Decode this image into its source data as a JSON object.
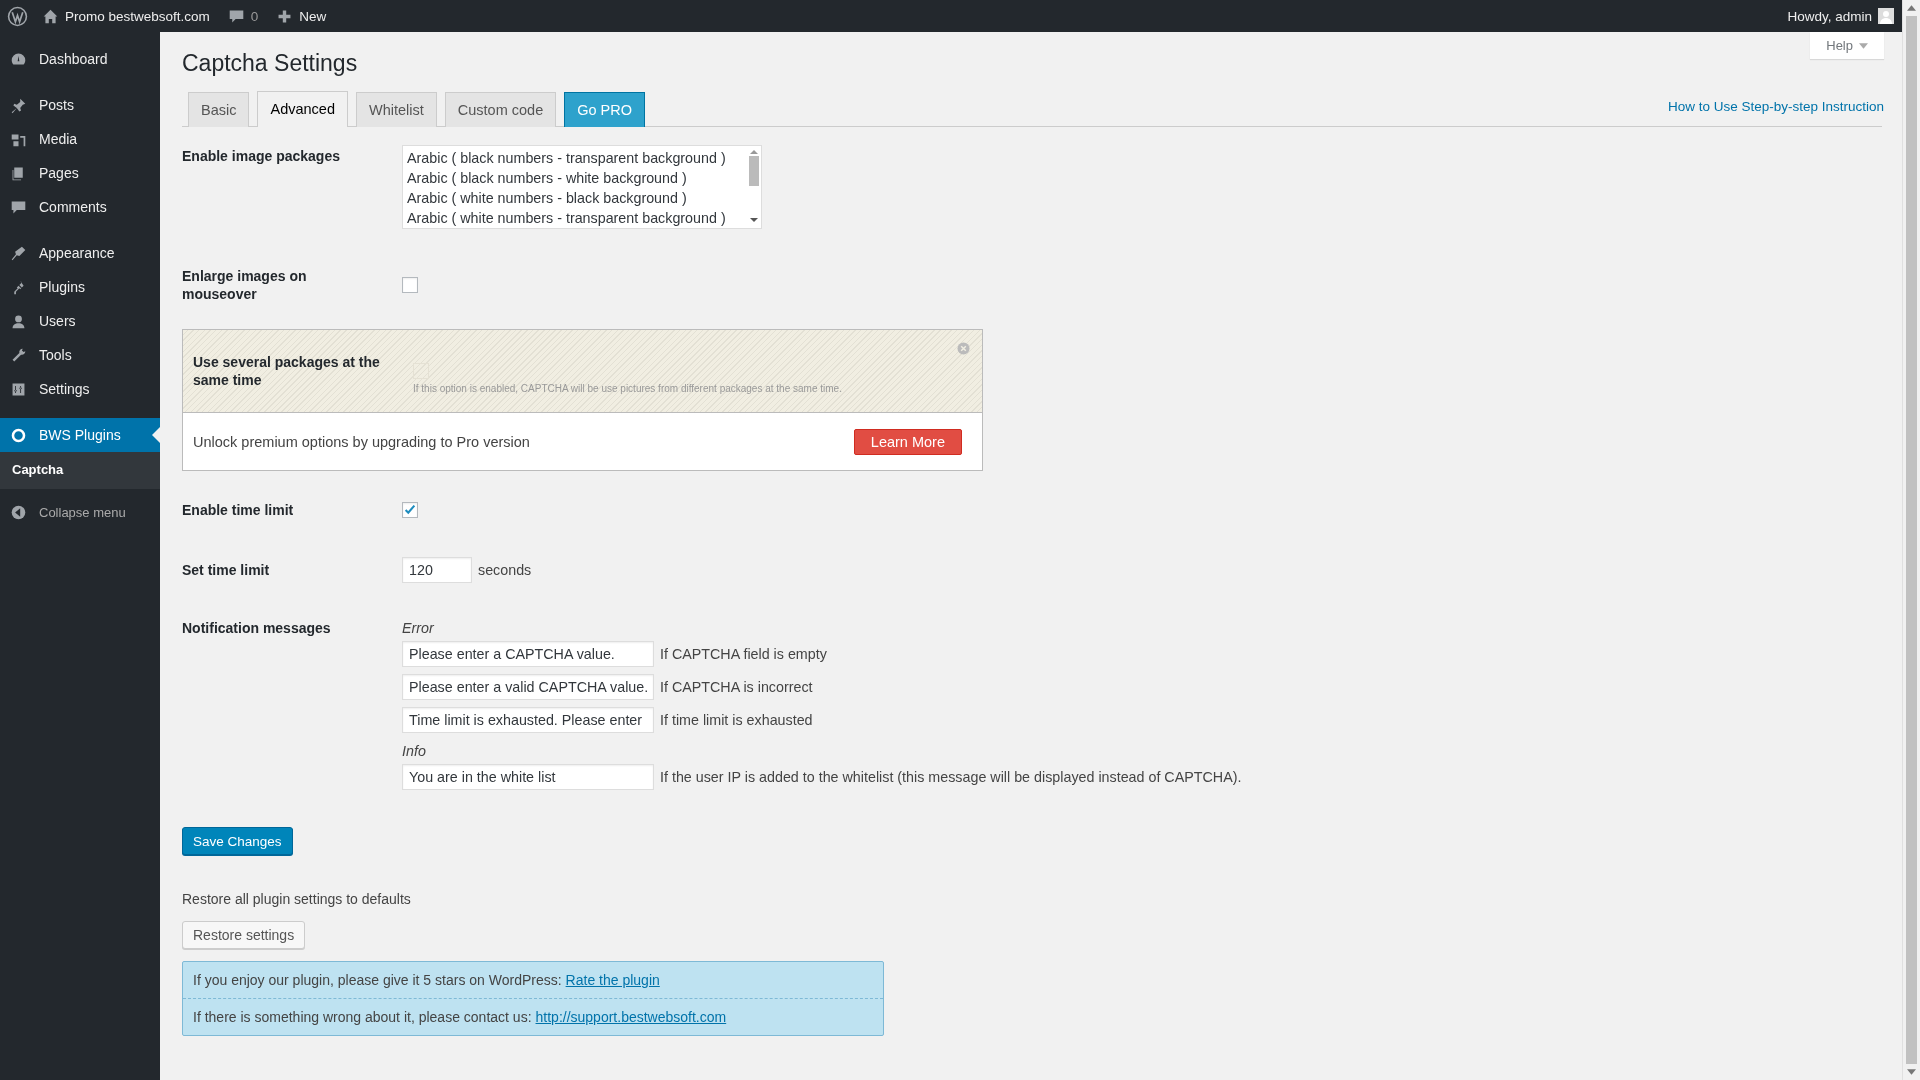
{
  "admin_bar": {
    "site": "Promo bestwebsoft.com",
    "comments": "0",
    "new": "New",
    "greeting": "Howdy, admin"
  },
  "sidebar": {
    "groups": [
      [
        {
          "label": "Dashboard",
          "selected": false
        }
      ],
      [
        {
          "label": "Posts",
          "selected": false
        },
        {
          "label": "Media",
          "selected": false
        },
        {
          "label": "Pages",
          "selected": false
        },
        {
          "label": "Comments",
          "selected": false
        }
      ],
      [
        {
          "label": "Appearance",
          "selected": false
        },
        {
          "label": "Plugins",
          "selected": false
        },
        {
          "label": "Users",
          "selected": false
        },
        {
          "label": "Tools",
          "selected": false
        },
        {
          "label": "Settings",
          "selected": false
        }
      ],
      [
        {
          "label": "BWS Plugins",
          "selected": true,
          "children": [
            {
              "label": "Captcha",
              "selected": true
            }
          ]
        }
      ]
    ],
    "collapse": "Collapse menu"
  },
  "page": {
    "title": "Captcha Settings",
    "help": "Help",
    "instruction_link": "How to Use Step-by-step Instruction",
    "tabs": [
      {
        "label": "Basic",
        "selected": false,
        "kind": "tab"
      },
      {
        "label": "Advanced",
        "selected": true,
        "kind": "tab"
      },
      {
        "label": "Whitelist",
        "selected": false,
        "kind": "tab"
      },
      {
        "label": "Custom code",
        "selected": false,
        "kind": "tab"
      },
      {
        "label": "Go PRO",
        "selected": false,
        "kind": "pro"
      }
    ]
  },
  "image_packages": {
    "label": "Enable image packages",
    "options": [
      "Arabic ( black numbers - transparent background )",
      "Arabic ( black numbers - white background )",
      "Arabic ( white numbers - black background )",
      "Arabic ( white numbers - transparent background )"
    ]
  },
  "enlarge": {
    "label": "Enlarge images on mouseover",
    "checked": false
  },
  "pro_box": {
    "label": "Use several packages at the same time",
    "checked": false,
    "description": "If this option is enabled, CAPTCHA will be use pictures from different packages at the same time.",
    "unlock": "Unlock premium options by upgrading to Pro version",
    "button": "Learn More"
  },
  "time_limit": {
    "label": "Enable time limit",
    "checked": true
  },
  "set_time": {
    "label": "Set time limit",
    "value": "120",
    "unit": "seconds"
  },
  "notifications": {
    "label": "Notification messages",
    "groups": [
      {
        "heading": "Error",
        "messages": [
          {
            "value": "Please enter a CAPTCHA value.",
            "hint": "If CAPTCHA field is empty"
          },
          {
            "value": "Please enter a valid CAPTCHA value.",
            "hint": "If CAPTCHA is incorrect"
          },
          {
            "value": "Time limit is exhausted. Please enter",
            "hint": "If time limit is exhausted"
          }
        ]
      },
      {
        "heading": "Info",
        "messages": [
          {
            "value": "You are in the white list",
            "hint": "If the user IP is added to the whitelist (this message will be displayed instead of CAPTCHA)."
          }
        ]
      }
    ]
  },
  "save": "Save Changes",
  "restore": {
    "text": "Restore all plugin settings to defaults",
    "button": "Restore settings"
  },
  "support": [
    {
      "text": "If you enjoy our plugin, please give it 5 stars on WordPress:",
      "link": "Rate the plugin"
    },
    {
      "text": "If there is something wrong about it, please contact us:",
      "link": "http://support.bestwebsoft.com"
    }
  ]
}
